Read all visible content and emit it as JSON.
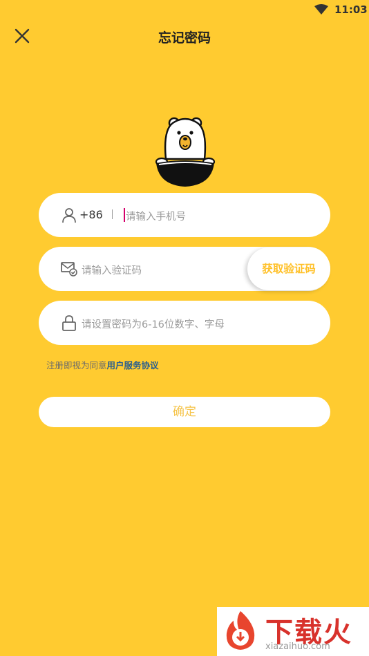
{
  "status_bar": {
    "time": "11:03",
    "wifi_icon": "wifi-icon"
  },
  "header": {
    "title": "忘记密码",
    "close_icon": "close-icon"
  },
  "mascot": {
    "icon": "bear-mascot-logo"
  },
  "phone_field": {
    "country_code": "+86",
    "arrow": "›",
    "placeholder": "请输入手机号",
    "icon": "user-icon"
  },
  "code_field": {
    "placeholder": "请输入验证码",
    "icon": "mail-check-icon",
    "get_code_label": "获取验证码"
  },
  "password_field": {
    "placeholder": "请设置密码为6-16位数字、字母",
    "icon": "lock-icon"
  },
  "agreement": {
    "prefix": "注册即视为同意",
    "link": "用户服务协议"
  },
  "confirm_button": {
    "label": "确定"
  },
  "watermark": {
    "brand": "下载火",
    "url": "xiazaihuo.com"
  },
  "colors": {
    "background": "#FFCB30",
    "accent": "#FFC12A",
    "link": "#2a5e8e"
  }
}
